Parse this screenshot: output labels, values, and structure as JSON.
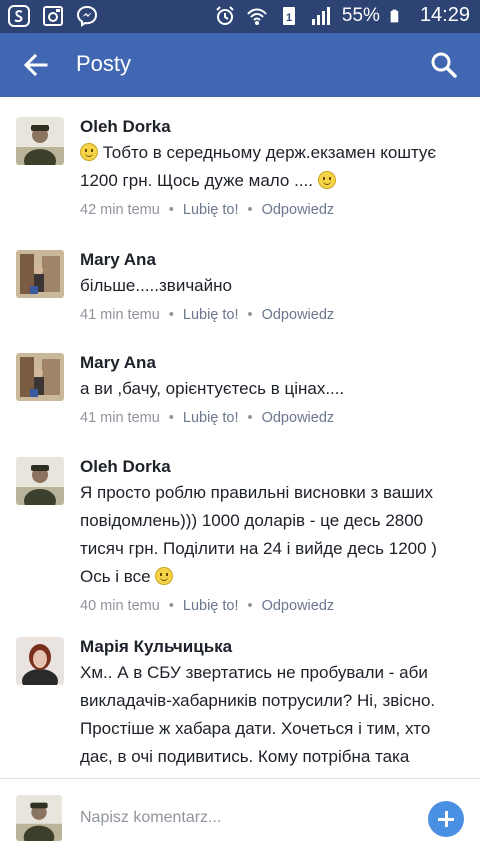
{
  "status_bar": {
    "battery": "55%",
    "time": "14:29"
  },
  "app_bar": {
    "title": "Posty"
  },
  "comments": [
    {
      "author": "Oleh Dorka",
      "text_before": "Тобто в середньому держ.екзамен коштує 1200 грн. Щось дуже мало .... ",
      "time": "42 min temu",
      "like": "Lubię to!",
      "reply": "Odpowiedz"
    },
    {
      "author": "Mary Ana",
      "text": "більше.....звичайно",
      "time": "41 min temu",
      "like": "Lubię to!",
      "reply": "Odpowiedz"
    },
    {
      "author": "Mary Ana",
      "text": "а ви ,бачу, орієнтуєтесь в цінах....",
      "time": "41 min temu",
      "like": "Lubię to!",
      "reply": "Odpowiedz"
    },
    {
      "author": "Oleh Dorka",
      "text": "Я просто роблю правильні висновки з ваших повідомлень))) 1000 доларів - це десь 2800 тисяч грн. Поділити на 24 і вийде десь 1200 ) Ось і все ",
      "time": "40 min temu",
      "like": "Lubię to!",
      "reply": "Odpowiedz"
    },
    {
      "author": "Марія Кульчицька",
      "text": "Хм.. А в СБУ звертатись не пробували - аби викладачів-хабарників потрусили? Ні, звісно. Простіше ж хабара дати. Хочеться і тим, хто дає, в очі подивитись. Кому потрібна така благодійність, коли"
    }
  ],
  "composer": {
    "placeholder": "Napisz komentarz..."
  },
  "colors": {
    "app_bar": "#4267b2",
    "status_bar": "#2d4373",
    "plus_button": "#4a90e2",
    "meta_text": "#90949c"
  },
  "icons": [
    "app-s-icon",
    "gallery-icon",
    "messenger-icon",
    "alarm-icon",
    "wifi-icon",
    "sim-icon",
    "signal-icon",
    "battery-icon",
    "back-arrow-icon",
    "search-icon",
    "plus-icon",
    "smile-emoji-icon"
  ]
}
